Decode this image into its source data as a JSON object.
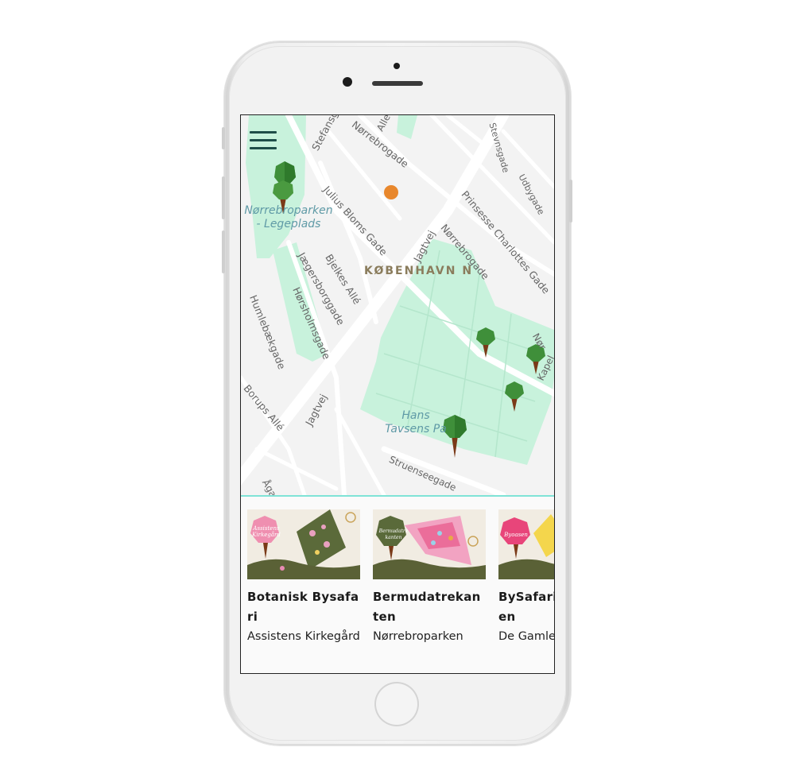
{
  "map": {
    "district_label": "KØBENHAVN N",
    "places": [
      {
        "id": "norrebroparken-legeplads",
        "line1": "Nørrebroparken",
        "line2": "- Legeplads"
      },
      {
        "id": "hans-tavsens-park",
        "line1": "Hans",
        "line2": "Tavsens Pa"
      }
    ],
    "streets": [
      "Stefansgade",
      "Nørrebrogade",
      "Alle",
      "Julius Bloms Gade",
      "Jagtvej",
      "Nørrebrogade",
      "Prinsesse Charlottes Gade",
      "Stevnsgade",
      "Udbygade",
      "Bjelkes Allé",
      "Jægersborggade",
      "Hørsholmsgade",
      "Humlebækgade",
      "Borups Allé",
      "Jagtvej",
      "Struenseegade",
      "Ågade",
      "Kapel",
      "Nør"
    ],
    "colors": {
      "park": "#c8f2dc",
      "road": "#ffffff",
      "background": "#f3f3f3",
      "marker": "#e8872c",
      "label": "#8a7c5c",
      "place_label": "#5f9aa6"
    }
  },
  "menu": {
    "icon": "hamburger-menu-icon"
  },
  "cards": [
    {
      "title": "Botanisk Bysafari",
      "subtitle": "Assistens Kirkegård",
      "thumb_label": "Assistens Kirkegård",
      "accent": "#ef8fb0"
    },
    {
      "title": "Bermudatrekanten",
      "subtitle": "Nørrebroparken",
      "thumb_label": "Bermudatrekanten",
      "accent": "#5a6a3a"
    },
    {
      "title": "BySafari ByOasen",
      "subtitle": "De Gamle",
      "thumb_label": "Byoasen",
      "accent": "#e8457a"
    }
  ]
}
